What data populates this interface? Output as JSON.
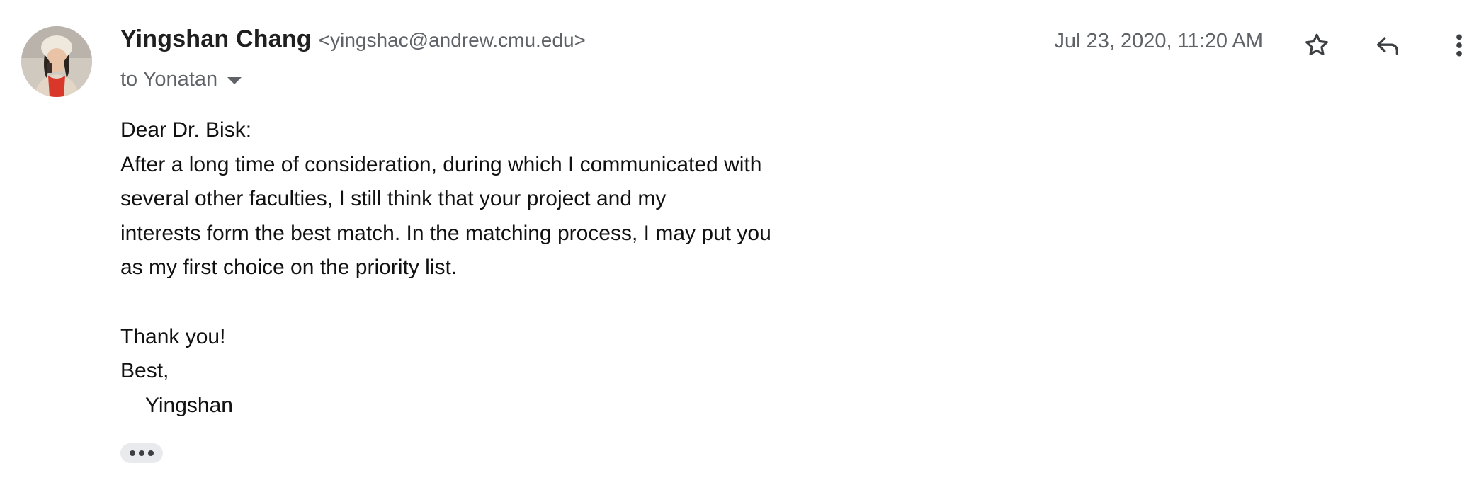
{
  "message": {
    "sender_name": "Yingshan Chang",
    "sender_email": "<yingshac@andrew.cmu.edu>",
    "recipient": "to Yonatan",
    "date": "Jul 23, 2020, 11:20 AM",
    "icons": {
      "star": "star-icon",
      "reply": "reply-icon",
      "more": "more-vert-icon",
      "caret": "caret-down-icon",
      "trimmed": "more-horiz-icon"
    },
    "body": {
      "greeting": "Dear Dr. Bisk:",
      "lines": [
        "After a long time of consideration, during which I communicated with",
        "several other faculties, I still think that your project and my",
        "interests form the best match. In the matching process, I may put you",
        "as my first choice on the priority list."
      ],
      "thanks": "Thank you!",
      "closing": "Best,",
      "signature": "Yingshan"
    }
  },
  "colors": {
    "name": "#1f1f1f",
    "secondary": "#5f6368",
    "body_text": "#111111",
    "trim_button_bg": "#e8eaed"
  }
}
